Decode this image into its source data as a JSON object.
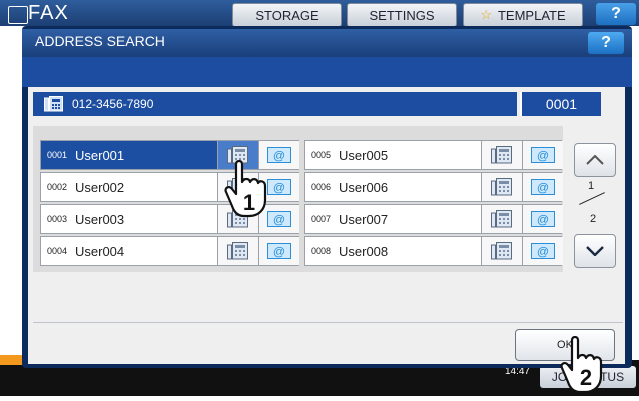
{
  "background": {
    "app_title": "FAX",
    "tabs": [
      "STORAGE",
      "SETTINGS",
      "TEMPLATE"
    ],
    "help_label": "?",
    "clock": "14:47",
    "job_status_label": "JOB STATUS"
  },
  "dialog": {
    "title": "ADDRESS SEARCH",
    "help_label": "?",
    "search_result": {
      "number": "012-3456-7890",
      "count": "0001"
    },
    "entries": [
      {
        "id": "0001",
        "name": "User001",
        "selected": true
      },
      {
        "id": "0002",
        "name": "User002",
        "selected": false
      },
      {
        "id": "0003",
        "name": "User003",
        "selected": false
      },
      {
        "id": "0004",
        "name": "User004",
        "selected": false
      },
      {
        "id": "0005",
        "name": "User005",
        "selected": false
      },
      {
        "id": "0006",
        "name": "User006",
        "selected": false
      },
      {
        "id": "0007",
        "name": "User007",
        "selected": false
      },
      {
        "id": "0008",
        "name": "User008",
        "selected": false
      }
    ],
    "pagination": {
      "current": "1",
      "total": "2"
    },
    "ok_label": "OK"
  },
  "callouts": [
    "1",
    "2"
  ],
  "colors": {
    "accent_blue": "#1d4da0",
    "dialog_frame": "#0c2a5c",
    "selected_row": "#1c4fa1",
    "body_bg": "#efefef",
    "mail_icon": "#2a8ed8"
  }
}
